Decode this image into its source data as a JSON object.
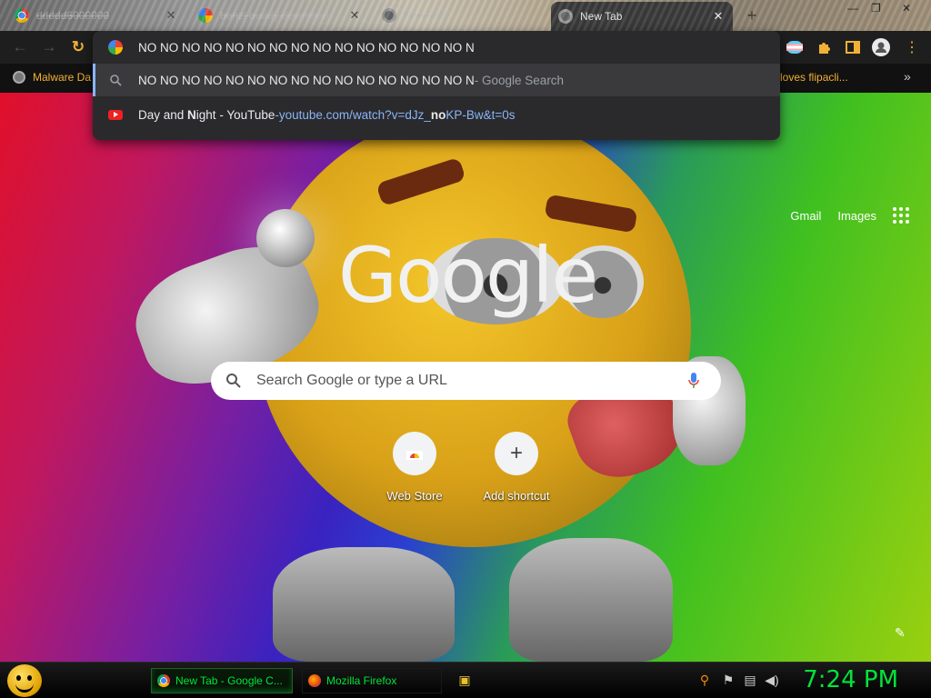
{
  "tabs": [
    {
      "title": "ddddd6000000",
      "favicon": "chrome-icon"
    },
    {
      "title": "bonzi buddy download",
      "favicon": "google-icon"
    },
    {
      "title": "New Tab",
      "favicon": "newtab-icon"
    },
    {
      "title": "New Tab",
      "favicon": "newtab-icon",
      "active": true
    }
  ],
  "omnibox": {
    "input_text": "NO NO NO NO NO NO NO NO NO NO NO NO NO NO NO N",
    "suggestions": [
      {
        "text": "NO NO NO NO NO NO NO NO NO NO NO NO NO NO NO N",
        "suffix": " - Google Search",
        "icon": "search-icon"
      },
      {
        "title_parts": [
          "Day and ",
          "N",
          "ight - YouTube"
        ],
        "sep": " - ",
        "url_parts": [
          "youtube.com/watch?v=dJz_",
          "no",
          "KP-Bw&t=0s"
        ],
        "icon": "youtube-icon"
      }
    ]
  },
  "bookmarks": {
    "left_item": "Malware Da",
    "right_item": "loves flipacli...",
    "more": "»"
  },
  "header": {
    "gmail": "Gmail",
    "images": "Images"
  },
  "page": {
    "logo": "Google",
    "search_placeholder": "Search Google or type a URL"
  },
  "shortcuts": [
    {
      "label": "Web Store"
    },
    {
      "label": "Add shortcut"
    }
  ],
  "taskbar": {
    "items": [
      {
        "label": "New Tab - Google C...",
        "active": true
      },
      {
        "label": "Mozilla Firefox",
        "active": false
      }
    ],
    "clock": "7:24 PM"
  },
  "colors": {
    "accent_green": "#00e53a",
    "toolbar_amber": "#f2b134",
    "link_blue": "#8ab4f8"
  }
}
